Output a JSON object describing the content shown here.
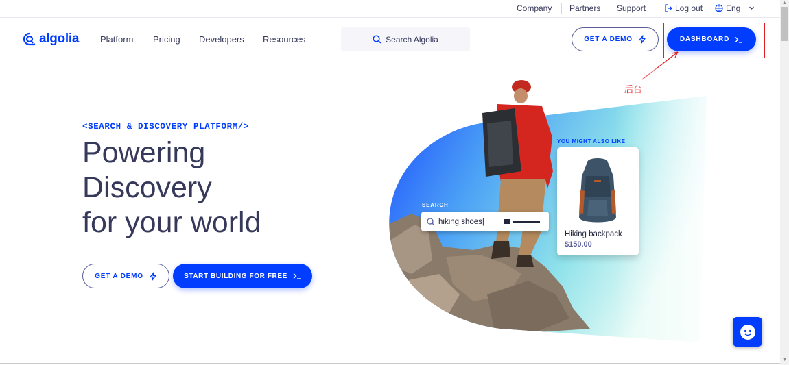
{
  "topbar": {
    "company": "Company",
    "partners": "Partners",
    "support": "Support",
    "logout": "Log out",
    "language": "Eng"
  },
  "nav": {
    "logo": "algolia",
    "items": [
      "Platform",
      "Pricing",
      "Developers",
      "Resources"
    ],
    "search_placeholder": "Search Algolia",
    "get_demo": "GET A DEMO",
    "dashboard": "DASHBOARD"
  },
  "annotation": {
    "label": "后台",
    "color": "#e02020"
  },
  "hero": {
    "eyebrow": "<SEARCH & DISCOVERY PLATFORM/>",
    "headline": [
      "Powering",
      "Discovery",
      "for your world"
    ],
    "get_demo": "GET A DEMO",
    "start_building": "START BUILDING FOR FREE"
  },
  "illustration": {
    "search_label": "SEARCH",
    "search_query": "hiking shoes|",
    "also_like": "YOU MIGHT ALSO LIKE",
    "product_name": "Hiking backpack",
    "product_price": "$150.00"
  },
  "colors": {
    "brand": "#003dff",
    "text": "#36395a"
  }
}
